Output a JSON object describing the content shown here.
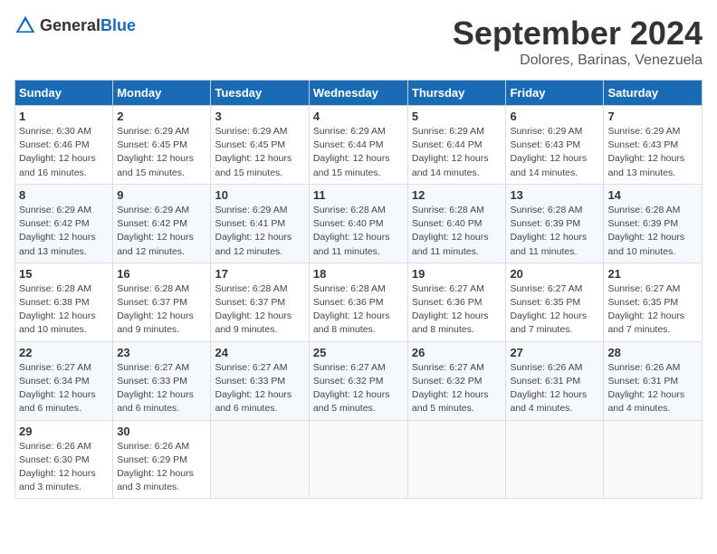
{
  "logo": {
    "text_general": "General",
    "text_blue": "Blue"
  },
  "title": "September 2024",
  "location": "Dolores, Barinas, Venezuela",
  "days_of_week": [
    "Sunday",
    "Monday",
    "Tuesday",
    "Wednesday",
    "Thursday",
    "Friday",
    "Saturday"
  ],
  "weeks": [
    [
      {
        "day": "1",
        "detail": "Sunrise: 6:30 AM\nSunset: 6:46 PM\nDaylight: 12 hours\nand 16 minutes."
      },
      {
        "day": "2",
        "detail": "Sunrise: 6:29 AM\nSunset: 6:45 PM\nDaylight: 12 hours\nand 15 minutes."
      },
      {
        "day": "3",
        "detail": "Sunrise: 6:29 AM\nSunset: 6:45 PM\nDaylight: 12 hours\nand 15 minutes."
      },
      {
        "day": "4",
        "detail": "Sunrise: 6:29 AM\nSunset: 6:44 PM\nDaylight: 12 hours\nand 15 minutes."
      },
      {
        "day": "5",
        "detail": "Sunrise: 6:29 AM\nSunset: 6:44 PM\nDaylight: 12 hours\nand 14 minutes."
      },
      {
        "day": "6",
        "detail": "Sunrise: 6:29 AM\nSunset: 6:43 PM\nDaylight: 12 hours\nand 14 minutes."
      },
      {
        "day": "7",
        "detail": "Sunrise: 6:29 AM\nSunset: 6:43 PM\nDaylight: 12 hours\nand 13 minutes."
      }
    ],
    [
      {
        "day": "8",
        "detail": "Sunrise: 6:29 AM\nSunset: 6:42 PM\nDaylight: 12 hours\nand 13 minutes."
      },
      {
        "day": "9",
        "detail": "Sunrise: 6:29 AM\nSunset: 6:42 PM\nDaylight: 12 hours\nand 12 minutes."
      },
      {
        "day": "10",
        "detail": "Sunrise: 6:29 AM\nSunset: 6:41 PM\nDaylight: 12 hours\nand 12 minutes."
      },
      {
        "day": "11",
        "detail": "Sunrise: 6:28 AM\nSunset: 6:40 PM\nDaylight: 12 hours\nand 11 minutes."
      },
      {
        "day": "12",
        "detail": "Sunrise: 6:28 AM\nSunset: 6:40 PM\nDaylight: 12 hours\nand 11 minutes."
      },
      {
        "day": "13",
        "detail": "Sunrise: 6:28 AM\nSunset: 6:39 PM\nDaylight: 12 hours\nand 11 minutes."
      },
      {
        "day": "14",
        "detail": "Sunrise: 6:28 AM\nSunset: 6:39 PM\nDaylight: 12 hours\nand 10 minutes."
      }
    ],
    [
      {
        "day": "15",
        "detail": "Sunrise: 6:28 AM\nSunset: 6:38 PM\nDaylight: 12 hours\nand 10 minutes."
      },
      {
        "day": "16",
        "detail": "Sunrise: 6:28 AM\nSunset: 6:37 PM\nDaylight: 12 hours\nand 9 minutes."
      },
      {
        "day": "17",
        "detail": "Sunrise: 6:28 AM\nSunset: 6:37 PM\nDaylight: 12 hours\nand 9 minutes."
      },
      {
        "day": "18",
        "detail": "Sunrise: 6:28 AM\nSunset: 6:36 PM\nDaylight: 12 hours\nand 8 minutes."
      },
      {
        "day": "19",
        "detail": "Sunrise: 6:27 AM\nSunset: 6:36 PM\nDaylight: 12 hours\nand 8 minutes."
      },
      {
        "day": "20",
        "detail": "Sunrise: 6:27 AM\nSunset: 6:35 PM\nDaylight: 12 hours\nand 7 minutes."
      },
      {
        "day": "21",
        "detail": "Sunrise: 6:27 AM\nSunset: 6:35 PM\nDaylight: 12 hours\nand 7 minutes."
      }
    ],
    [
      {
        "day": "22",
        "detail": "Sunrise: 6:27 AM\nSunset: 6:34 PM\nDaylight: 12 hours\nand 6 minutes."
      },
      {
        "day": "23",
        "detail": "Sunrise: 6:27 AM\nSunset: 6:33 PM\nDaylight: 12 hours\nand 6 minutes."
      },
      {
        "day": "24",
        "detail": "Sunrise: 6:27 AM\nSunset: 6:33 PM\nDaylight: 12 hours\nand 6 minutes."
      },
      {
        "day": "25",
        "detail": "Sunrise: 6:27 AM\nSunset: 6:32 PM\nDaylight: 12 hours\nand 5 minutes."
      },
      {
        "day": "26",
        "detail": "Sunrise: 6:27 AM\nSunset: 6:32 PM\nDaylight: 12 hours\nand 5 minutes."
      },
      {
        "day": "27",
        "detail": "Sunrise: 6:26 AM\nSunset: 6:31 PM\nDaylight: 12 hours\nand 4 minutes."
      },
      {
        "day": "28",
        "detail": "Sunrise: 6:26 AM\nSunset: 6:31 PM\nDaylight: 12 hours\nand 4 minutes."
      }
    ],
    [
      {
        "day": "29",
        "detail": "Sunrise: 6:26 AM\nSunset: 6:30 PM\nDaylight: 12 hours\nand 3 minutes."
      },
      {
        "day": "30",
        "detail": "Sunrise: 6:26 AM\nSunset: 6:29 PM\nDaylight: 12 hours\nand 3 minutes."
      },
      {
        "day": "",
        "detail": ""
      },
      {
        "day": "",
        "detail": ""
      },
      {
        "day": "",
        "detail": ""
      },
      {
        "day": "",
        "detail": ""
      },
      {
        "day": "",
        "detail": ""
      }
    ]
  ]
}
